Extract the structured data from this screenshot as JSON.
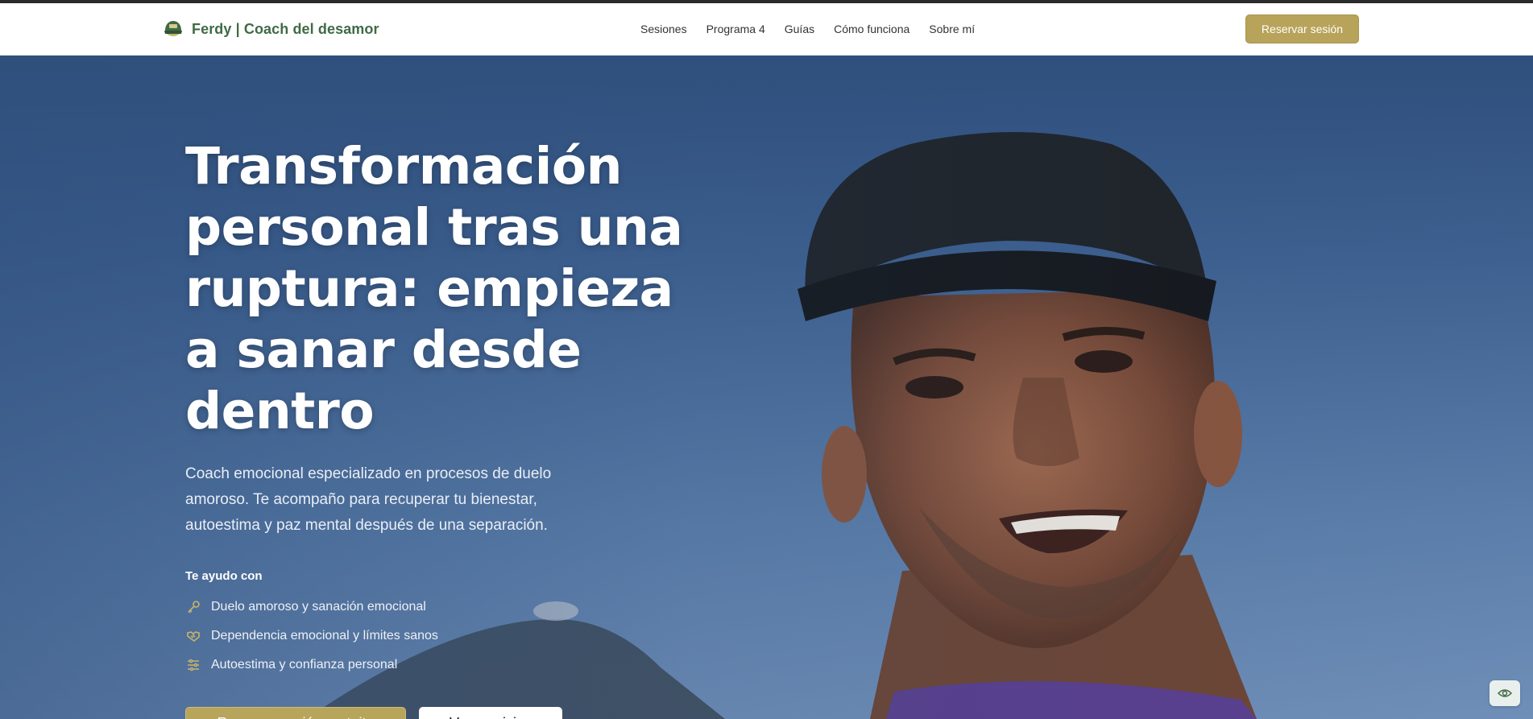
{
  "header": {
    "brand": "Ferdy | Coach del desamor",
    "logo_icon": "cap-icon",
    "nav": [
      "Sesiones",
      "Programa 4",
      "Guías",
      "Cómo funciona",
      "Sobre mí"
    ],
    "cta": "Reservar sesión"
  },
  "hero": {
    "title": "Transformación personal tras una ruptura: empieza a sanar desde dentro",
    "subtitle": "Coach emocional especializado en procesos de duelo amoroso. Te acompaño para recuperar tu bienestar, autoestima y paz mental después de una separación.",
    "help_title": "Te ayudo con",
    "help_items": [
      {
        "icon": "key-icon",
        "text": "Duelo amoroso y sanación emocional"
      },
      {
        "icon": "handshake-icon",
        "text": "Dependencia emocional y límites sanos"
      },
      {
        "icon": "sliders-icon",
        "text": "Autoestima y confianza personal"
      }
    ],
    "primary_button": "Reservar sesión gratuita",
    "secondary_button": "Ver servicios"
  },
  "floating_button_icon": "eye-icon",
  "colors": {
    "accent": "#b7a35a",
    "brand_green": "#3f6b45",
    "hero_sky": "#3d6090"
  }
}
